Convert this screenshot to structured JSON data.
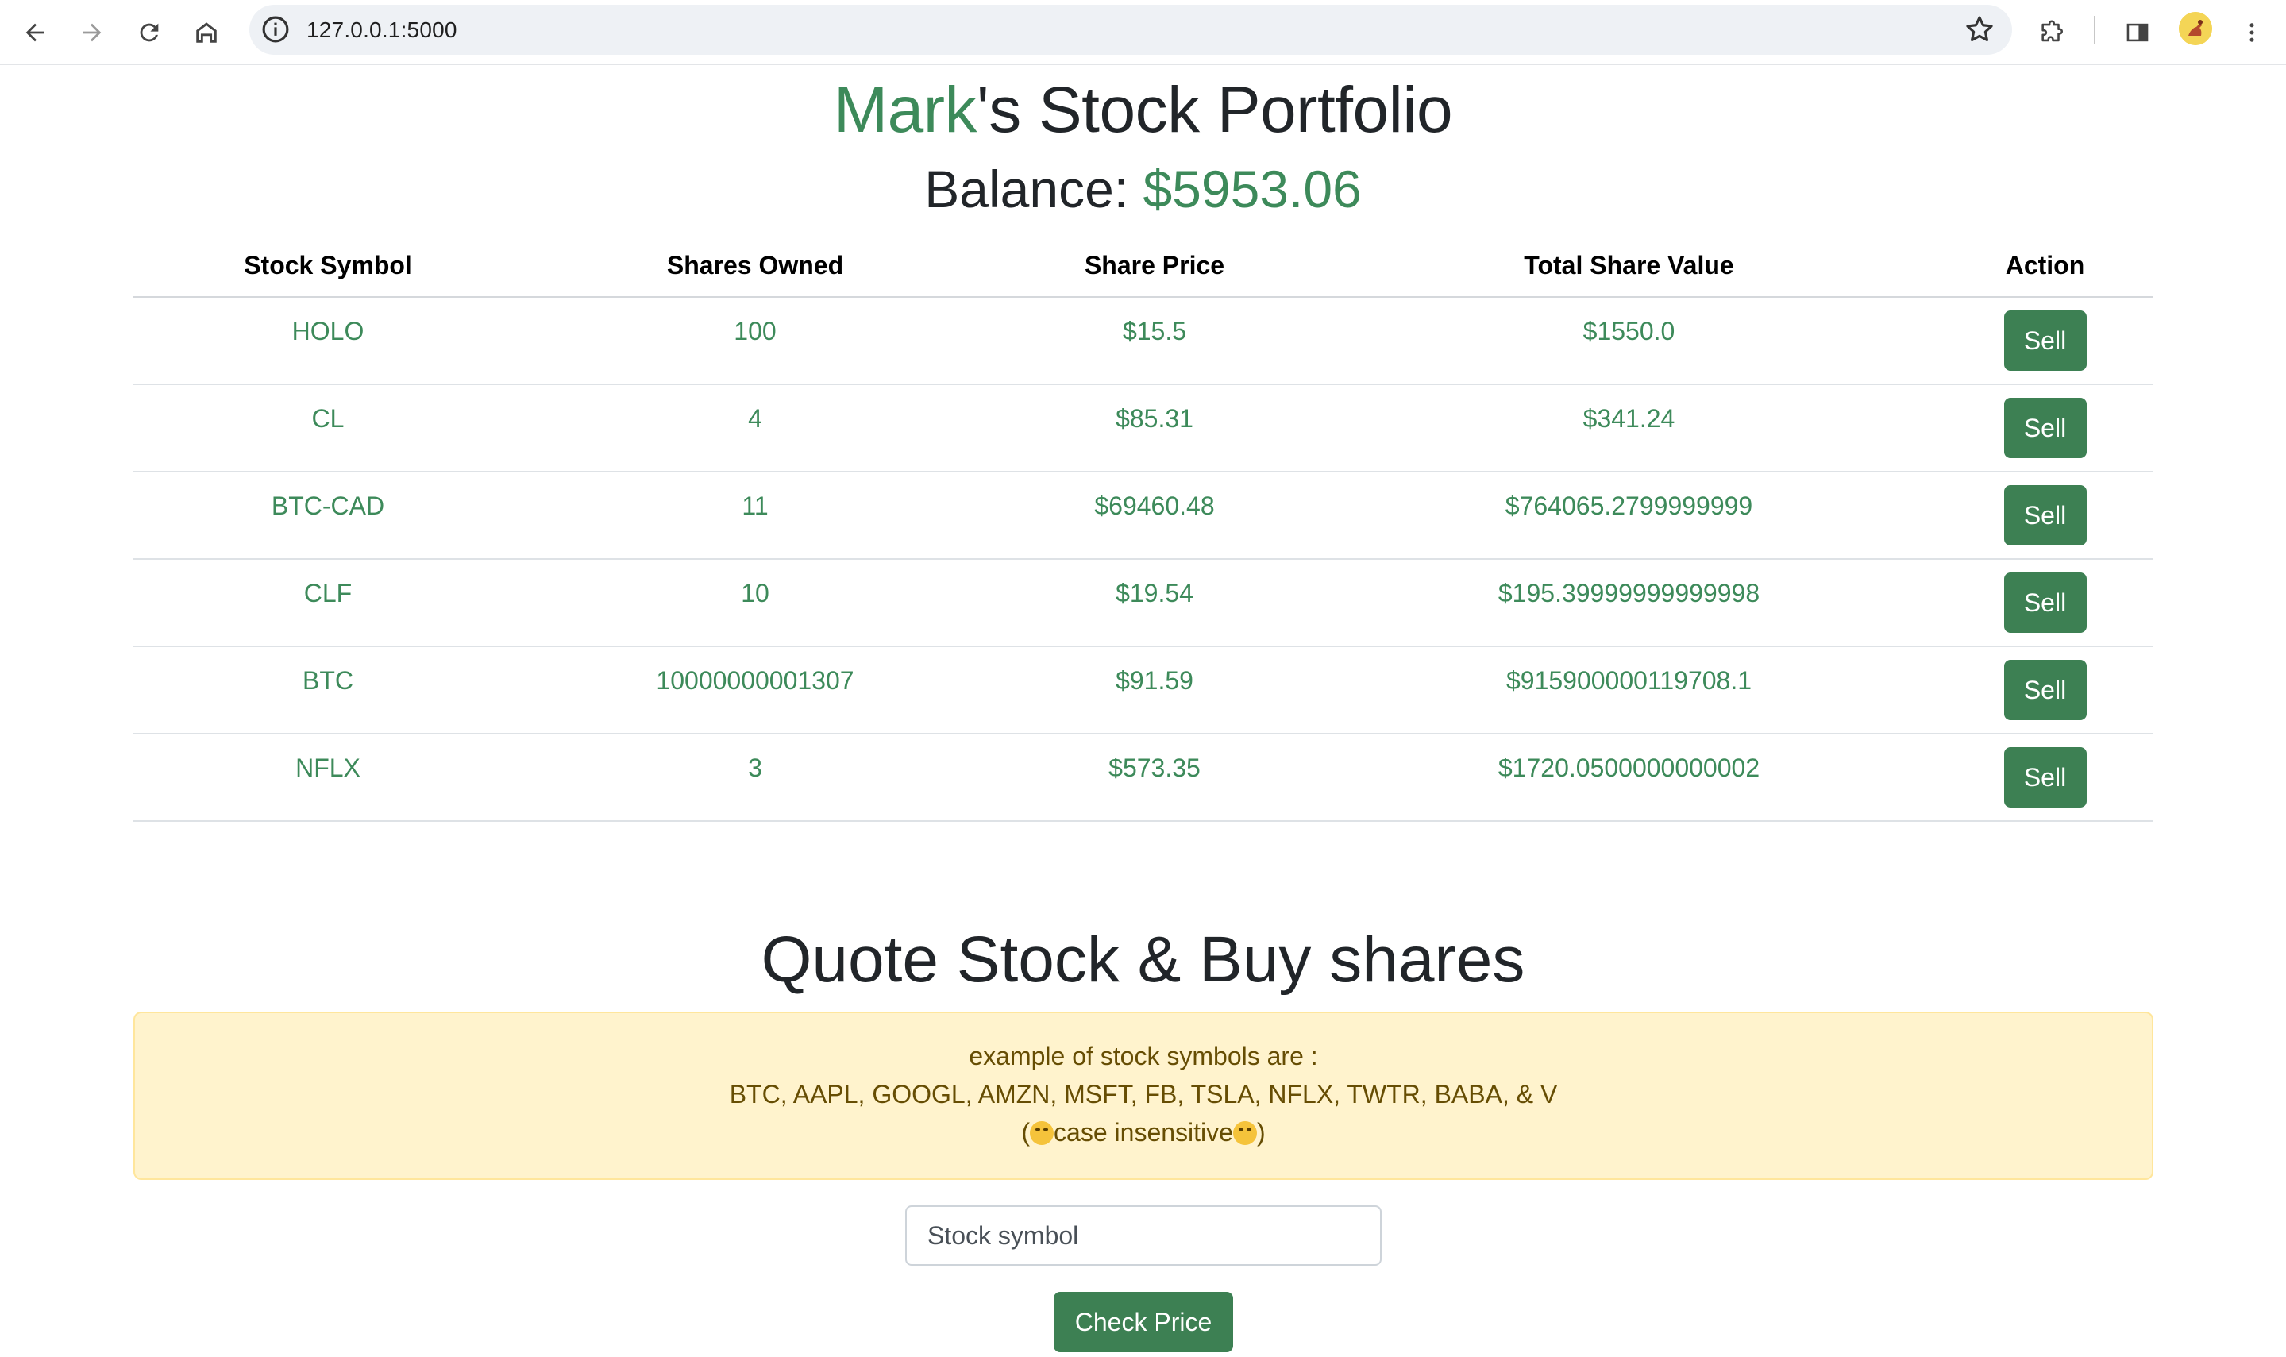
{
  "browser": {
    "url": "127.0.0.1:5000"
  },
  "header": {
    "owner_name": "Mark",
    "title_suffix": "'s Stock Portfolio",
    "balance_label": "Balance: ",
    "balance_amount": "$5953.06"
  },
  "table": {
    "columns": [
      "Stock Symbol",
      "Shares Owned",
      "Share Price",
      "Total Share Value",
      "Action"
    ],
    "rows": [
      {
        "symbol": "HOLO",
        "shares": "100",
        "price": "$15.5",
        "total": "$1550.0",
        "action": "Sell"
      },
      {
        "symbol": "CL",
        "shares": "4",
        "price": "$85.31",
        "total": "$341.24",
        "action": "Sell"
      },
      {
        "symbol": "BTC-CAD",
        "shares": "11",
        "price": "$69460.48",
        "total": "$764065.2799999999",
        "action": "Sell"
      },
      {
        "symbol": "CLF",
        "shares": "10",
        "price": "$19.54",
        "total": "$195.39999999999998",
        "action": "Sell"
      },
      {
        "symbol": "BTC",
        "shares": "10000000001307",
        "price": "$91.59",
        "total": "$915900000119708.1",
        "action": "Sell"
      },
      {
        "symbol": "NFLX",
        "shares": "3",
        "price": "$573.35",
        "total": "$1720.0500000000002",
        "action": "Sell"
      }
    ]
  },
  "quote": {
    "title": "Quote Stock & Buy shares",
    "hint_line1": "example of stock symbols are :",
    "hint_line2": "BTC, AAPL, GOOGL, AMZN, MSFT, FB, TSLA, NFLX, TWTR, BABA, & V",
    "hint_line3_open": "(",
    "hint_line3_text": "case insensitive",
    "hint_line3_close": ")",
    "hint_emoji": "smirk-emoji",
    "input_placeholder": "Stock symbol",
    "button_label": "Check Price"
  },
  "colors": {
    "accent_green": "#3d8a5a",
    "button_green": "#3d8053",
    "alert_bg": "#fff3cd"
  }
}
